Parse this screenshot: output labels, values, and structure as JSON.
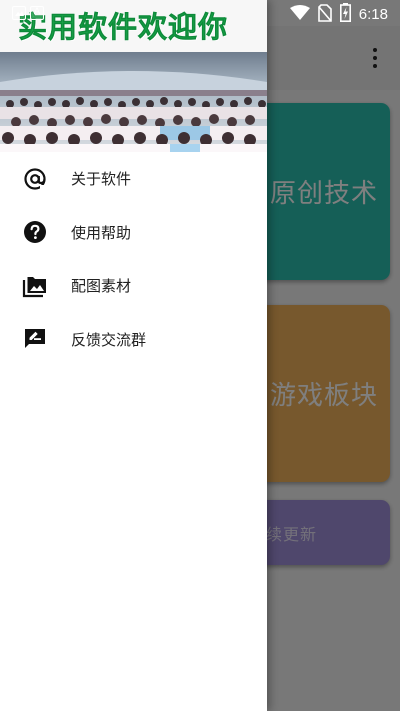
{
  "status_bar": {
    "time": "6:18",
    "icons": [
      "image-notification-icon",
      "font-notification-icon",
      "wifi-icon",
      "no-sim-icon",
      "battery-charging-icon"
    ]
  },
  "drawer": {
    "header_title": "实用软件欢迎你",
    "menu": [
      {
        "label": "关于软件",
        "icon": "at-sign-icon"
      },
      {
        "label": "使用帮助",
        "icon": "help-circle-icon"
      },
      {
        "label": "配图素材",
        "icon": "photo-library-icon"
      },
      {
        "label": "反馈交流群",
        "icon": "feedback-icon"
      }
    ]
  },
  "background": {
    "cards": [
      {
        "label": "原创技术",
        "visible_label": "原创技术",
        "color": "#2bbfaf"
      },
      {
        "label": "游戏板块",
        "visible_label": "游戏板块",
        "color": "#eeb05a"
      },
      {
        "label": "继续更新",
        "visible_label": "续更新",
        "color": "#9f8ed8"
      }
    ]
  },
  "colors": {
    "title_green": "#1aa84b",
    "scrim": "rgba(0,0,0,0.5)"
  }
}
